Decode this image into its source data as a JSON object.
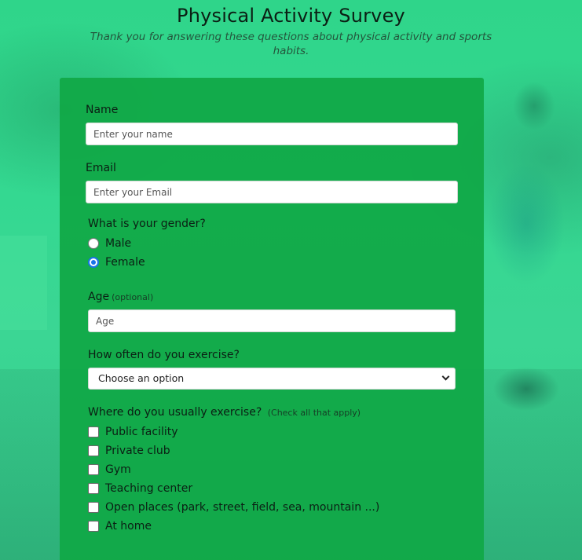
{
  "header": {
    "title": "Physical Activity Survey",
    "subtitle": "Thank you for answering these questions about physical activity and sports habits."
  },
  "form": {
    "name": {
      "label": "Name",
      "placeholder": "Enter your name",
      "value": ""
    },
    "email": {
      "label": "Email",
      "placeholder": "Enter your Email",
      "value": ""
    },
    "gender": {
      "question": "What is your gender?",
      "options": [
        {
          "label": "Male",
          "checked": false
        },
        {
          "label": "Female",
          "checked": true
        }
      ]
    },
    "age": {
      "label": "Age",
      "hint": "(optional)",
      "placeholder": "Age",
      "value": ""
    },
    "frequency": {
      "question": "How often do you exercise?",
      "selected": "Choose an option"
    },
    "locations": {
      "question": "Where do you usually exercise?",
      "hint": "(Check all that apply)",
      "options": [
        {
          "label": "Public facility",
          "checked": false
        },
        {
          "label": "Private club",
          "checked": false
        },
        {
          "label": "Gym",
          "checked": false
        },
        {
          "label": "Teaching center",
          "checked": false
        },
        {
          "label": "Open places (park, street, field, sea, mountain ...)",
          "checked": false
        },
        {
          "label": "At home",
          "checked": false
        }
      ]
    }
  },
  "colors": {
    "card": "#10a846",
    "background": "#33d98c",
    "radio_accent": "#1a73e8"
  }
}
